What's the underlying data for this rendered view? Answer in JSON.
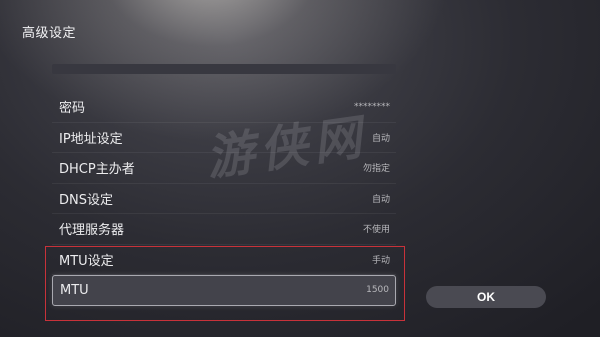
{
  "page": {
    "title": "高级设定"
  },
  "watermark": {
    "text": "游侠网"
  },
  "settings": {
    "items": [
      {
        "label": "密码",
        "value": "********"
      },
      {
        "label": "IP地址设定",
        "value": "自动"
      },
      {
        "label": "DHCP主办者",
        "value": "勿指定"
      },
      {
        "label": "DNS设定",
        "value": "自动"
      },
      {
        "label": "代理服务器",
        "value": "不使用"
      },
      {
        "label": "MTU设定",
        "value": "手动"
      },
      {
        "label": "MTU",
        "value": "1500"
      }
    ],
    "selected_label": "MTU"
  },
  "actions": {
    "ok_label": "OK"
  },
  "colors": {
    "highlight_border": "#c8323a",
    "background": "#2c2c33"
  }
}
